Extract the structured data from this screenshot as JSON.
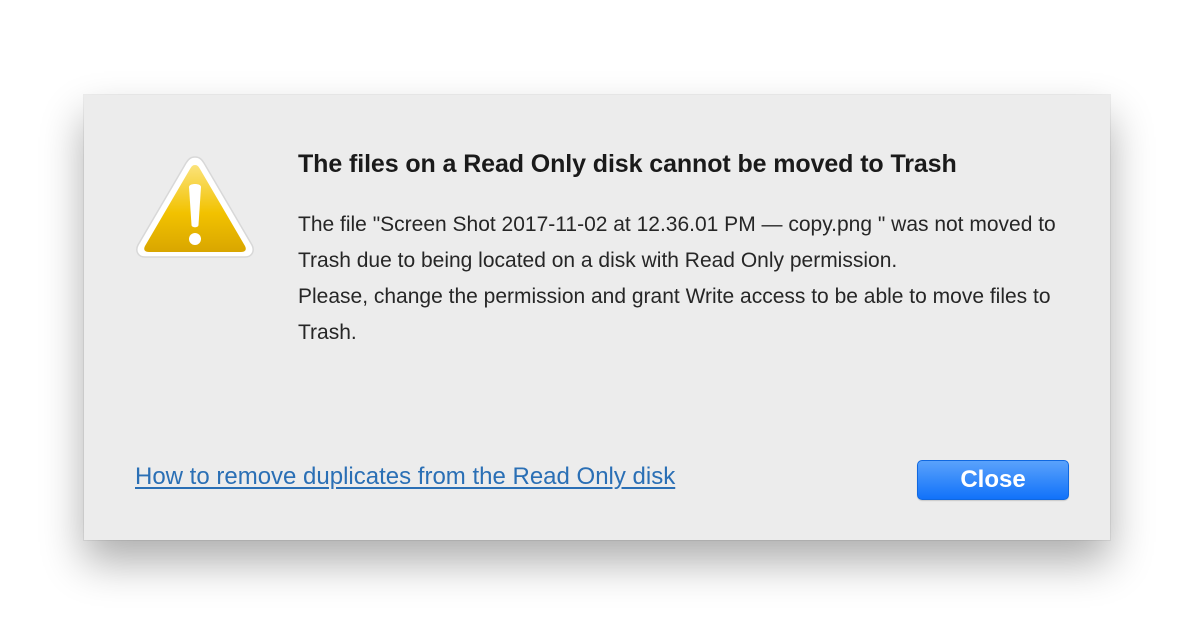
{
  "dialog": {
    "icon": "warning-triangle-icon",
    "title": "The files on a Read Only disk cannot be moved to Trash",
    "message_line1": "The file \"Screen Shot 2017-11-02 at 12.36.01 PM  —  copy.png \" was not moved to Trash due to being located on a disk with Read Only permission.",
    "message_line2": "Please, change the permission and grant Write access to be able to move files to Trash.",
    "help_link": "How to remove duplicates from the Read Only disk",
    "close_label": "Close",
    "colors": {
      "background": "#ececec",
      "link": "#2a6fb5",
      "button": "#1172fa",
      "icon_fill": "#f2c200"
    }
  }
}
